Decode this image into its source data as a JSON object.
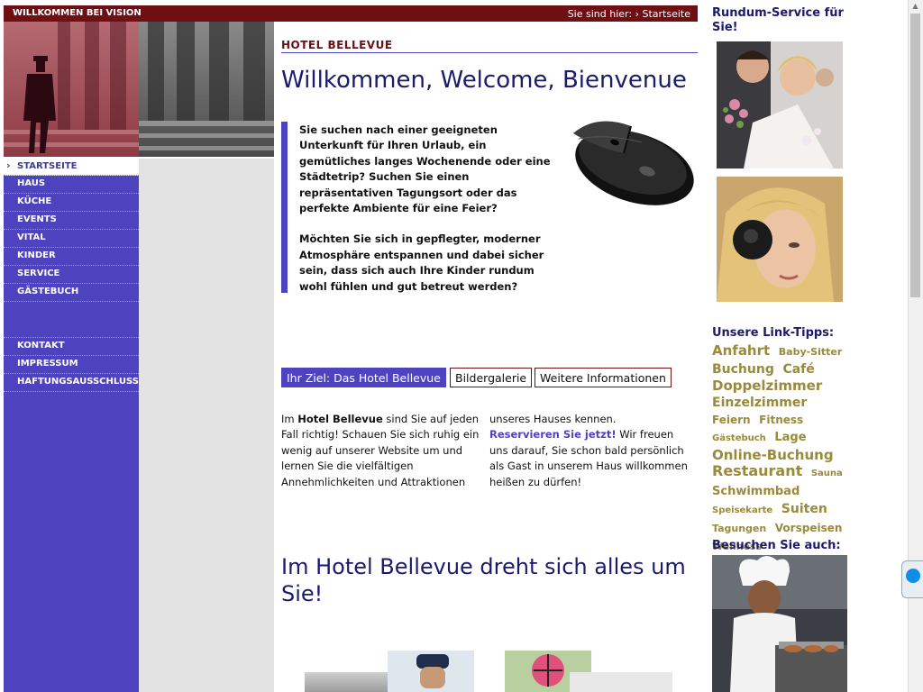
{
  "header": {
    "brand": "WILLKOMMEN BEI VISION",
    "breadcrumb_prefix": "Sie sind hier:",
    "breadcrumb_current": "Startseite"
  },
  "nav": {
    "active": "STARTSEITE",
    "items": [
      "HAUS",
      "KÜCHE",
      "EVENTS",
      "VITAL",
      "KINDER",
      "SERVICE",
      "GÄSTEBUCH"
    ],
    "items2": [
      "KONTAKT",
      "IMPRESSUM",
      "HAFTUNGSAUSSCHLUSS"
    ]
  },
  "main": {
    "hotel_title": "HOTEL BELLEVUE",
    "welcome": "Willkommen, Welcome, Bienvenue",
    "quote_p1": "Sie suchen nach einer geeigneten Unterkunft für Ihren Urlaub, ein gemütliches langes Wochenende oder eine Städtetrip? Suchen Sie einen repräsentativen Tagungsort oder das perfekte Ambiente für eine Feier?",
    "quote_p2": "Möchten Sie sich in gepflegter, moderner Atmosphäre entspannen und dabei sicher sein, dass sich auch Ihre Kinder rundum wohl fühlen und gut betreut werden?",
    "btn_ziel": "Ihr Ziel: Das Hotel Bellevue",
    "btn_galerie": "Bildergalerie",
    "btn_info": "Weitere Informationen",
    "col1_pre": "Im ",
    "col1_bold": "Hotel Bellevue",
    "col1_post": " sind Sie auf jeden Fall richtig! Schauen Sie sich ruhig ein wenig auf unserer Website um und lernen Sie die vielfältigen Annehmlichkeiten und Attraktionen",
    "col2_pre": "unseres Hauses kennen.",
    "col2_link": "Reservieren Sie jetzt!",
    "col2_post": " Wir freuen uns darauf, Sie schon bald persönlich als Gast in unserem Haus willkommen heißen zu dürfen!",
    "heading2": "Im Hotel Bellevue dreht sich alles um Sie!"
  },
  "sidebar": {
    "rundum": "Rundum-Service für Sie!",
    "link_tipps_title": "Unsere Link-Tipps:",
    "tags": [
      {
        "text": "Anfahrt",
        "size": 15
      },
      {
        "text": "Baby-Sitter",
        "size": 11
      },
      {
        "text": "Buchung",
        "size": 14
      },
      {
        "text": "Café",
        "size": 14
      },
      {
        "text": "Doppelzimmer",
        "size": 15
      },
      {
        "text": "Einzelzimmer",
        "size": 14
      },
      {
        "text": "Feiern",
        "size": 12
      },
      {
        "text": "Fitness",
        "size": 12
      },
      {
        "text": "Gästebuch",
        "size": 10
      },
      {
        "text": "Lage",
        "size": 13
      },
      {
        "text": "Online-Buchung",
        "size": 15
      },
      {
        "text": "Restaurant",
        "size": 16
      },
      {
        "text": "Sauna",
        "size": 10
      },
      {
        "text": "Schwimmbad",
        "size": 13
      },
      {
        "text": "Speisekarte",
        "size": 10
      },
      {
        "text": "Suiten",
        "size": 14
      },
      {
        "text": "Tagungen",
        "size": 11
      },
      {
        "text": "Vorspeisen",
        "size": 12
      },
      {
        "text": "Wellness",
        "size": 11
      }
    ],
    "besuchen": "Besuchen Sie auch:"
  },
  "colors": {
    "brand_red": "#6e0f14",
    "nav_blue": "#4e43bf",
    "heading_navy": "#1a1a6e",
    "tag_olive": "#9a8a3a"
  }
}
